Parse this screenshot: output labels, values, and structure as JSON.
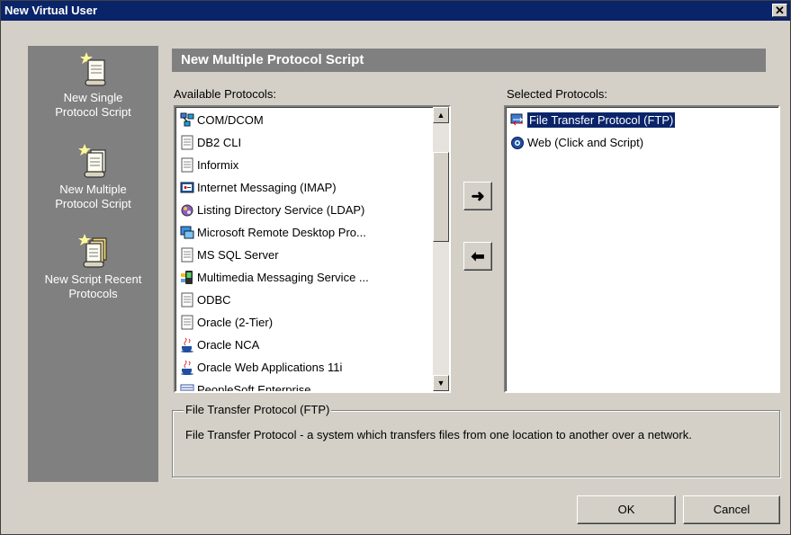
{
  "window": {
    "title": "New Virtual User",
    "close_glyph": "✕"
  },
  "left_panel": {
    "options": [
      {
        "label_line1": "New Single",
        "label_line2": "Protocol Script",
        "icon": "single-script-icon"
      },
      {
        "label_line1": "New Multiple",
        "label_line2": "Protocol Script",
        "icon": "multiple-script-icon"
      },
      {
        "label_line1": "New Script Recent",
        "label_line2": "Protocols",
        "icon": "recent-script-icon"
      }
    ]
  },
  "header": {
    "title": "New Multiple Protocol Script"
  },
  "available": {
    "label": "Available Protocols:",
    "items": [
      {
        "label": "COM/DCOM",
        "icon": "com-icon"
      },
      {
        "label": "DB2 CLI",
        "icon": "doc-icon"
      },
      {
        "label": "Informix",
        "icon": "doc-icon"
      },
      {
        "label": "Internet Messaging (IMAP)",
        "icon": "imap-icon"
      },
      {
        "label": "Listing Directory Service (LDAP)",
        "icon": "ldap-icon"
      },
      {
        "label": "Microsoft Remote Desktop Pro...",
        "icon": "rdp-icon"
      },
      {
        "label": "MS SQL Server",
        "icon": "doc-icon"
      },
      {
        "label": "Multimedia Messaging Service ...",
        "icon": "mms-icon"
      },
      {
        "label": "ODBC",
        "icon": "doc-icon"
      },
      {
        "label": "Oracle (2-Tier)",
        "icon": "doc-icon"
      },
      {
        "label": "Oracle NCA",
        "icon": "java-icon"
      },
      {
        "label": "Oracle Web Applications 11i",
        "icon": "java-icon"
      },
      {
        "label": "PeopleSoft Enterprise",
        "icon": "peoplesoft-icon"
      }
    ]
  },
  "selected": {
    "label": "Selected Protocols:",
    "items": [
      {
        "label": "File Transfer Protocol (FTP)",
        "icon": "ftp-icon",
        "selected": true
      },
      {
        "label": "Web (Click and Script)",
        "icon": "web-icon",
        "selected": false
      }
    ]
  },
  "buttons": {
    "add_arrow": "➜",
    "remove_arrow": "⬅",
    "ok": "OK",
    "cancel": "Cancel"
  },
  "description": {
    "title": "File Transfer Protocol (FTP)",
    "text": "File Transfer Protocol - a system which transfers files from one location to another over a network."
  }
}
